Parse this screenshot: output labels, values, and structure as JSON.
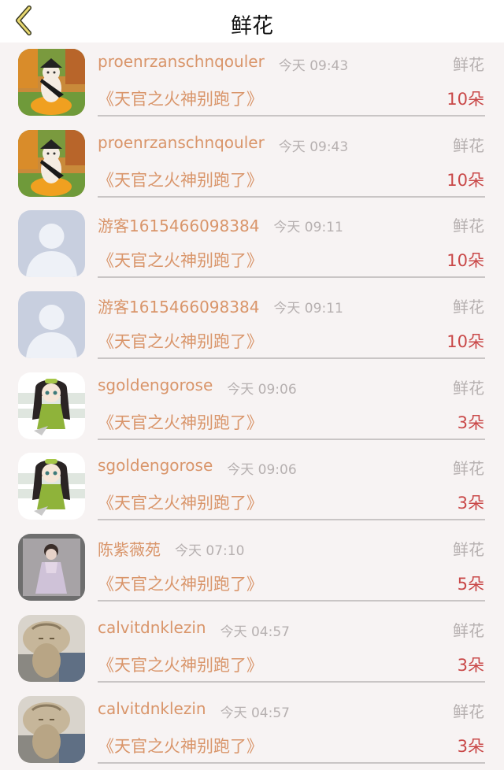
{
  "header": {
    "title": "鲜花",
    "back_icon": "chevron-left-icon"
  },
  "colors": {
    "name": "#d9956a",
    "count": "#c94848",
    "muted": "#b6b0b0"
  },
  "rows": [
    {
      "avatar": "cat-avatar",
      "name": "proenrzanschnqouler",
      "time": "今天 09:43",
      "gift": "鲜花",
      "book": "《天官之火神别跑了》",
      "count": "10朵"
    },
    {
      "avatar": "cat-avatar",
      "name": "proenrzanschnqouler",
      "time": "今天 09:43",
      "gift": "鲜花",
      "book": "《天官之火神别跑了》",
      "count": "10朵"
    },
    {
      "avatar": "default-avatar",
      "name": "游客1615466098384",
      "time": "今天 09:11",
      "gift": "鲜花",
      "book": "《天官之火神别跑了》",
      "count": "10朵"
    },
    {
      "avatar": "default-avatar",
      "name": "游客1615466098384",
      "time": "今天 09:11",
      "gift": "鲜花",
      "book": "《天官之火神别跑了》",
      "count": "10朵"
    },
    {
      "avatar": "anime-girl-avatar",
      "name": "sgoldengorose",
      "time": "今天 09:06",
      "gift": "鲜花",
      "book": "《天官之火神别跑了》",
      "count": "3朵"
    },
    {
      "avatar": "anime-girl-avatar",
      "name": "sgoldengorose",
      "time": "今天 09:06",
      "gift": "鲜花",
      "book": "《天官之火神别跑了》",
      "count": "3朵"
    },
    {
      "avatar": "portrait-avatar",
      "name": "陈紫薇苑",
      "time": "今天 07:10",
      "gift": "鲜花",
      "book": "《天官之火神别跑了》",
      "count": "5朵"
    },
    {
      "avatar": "sleeping-cat-avatar",
      "name": "calvitdnklezin",
      "time": "今天 04:57",
      "gift": "鲜花",
      "book": "《天官之火神别跑了》",
      "count": "3朵"
    },
    {
      "avatar": "sleeping-cat-avatar",
      "name": "calvitdnklezin",
      "time": "今天 04:57",
      "gift": "鲜花",
      "book": "《天官之火神别跑了》",
      "count": "3朵"
    }
  ]
}
